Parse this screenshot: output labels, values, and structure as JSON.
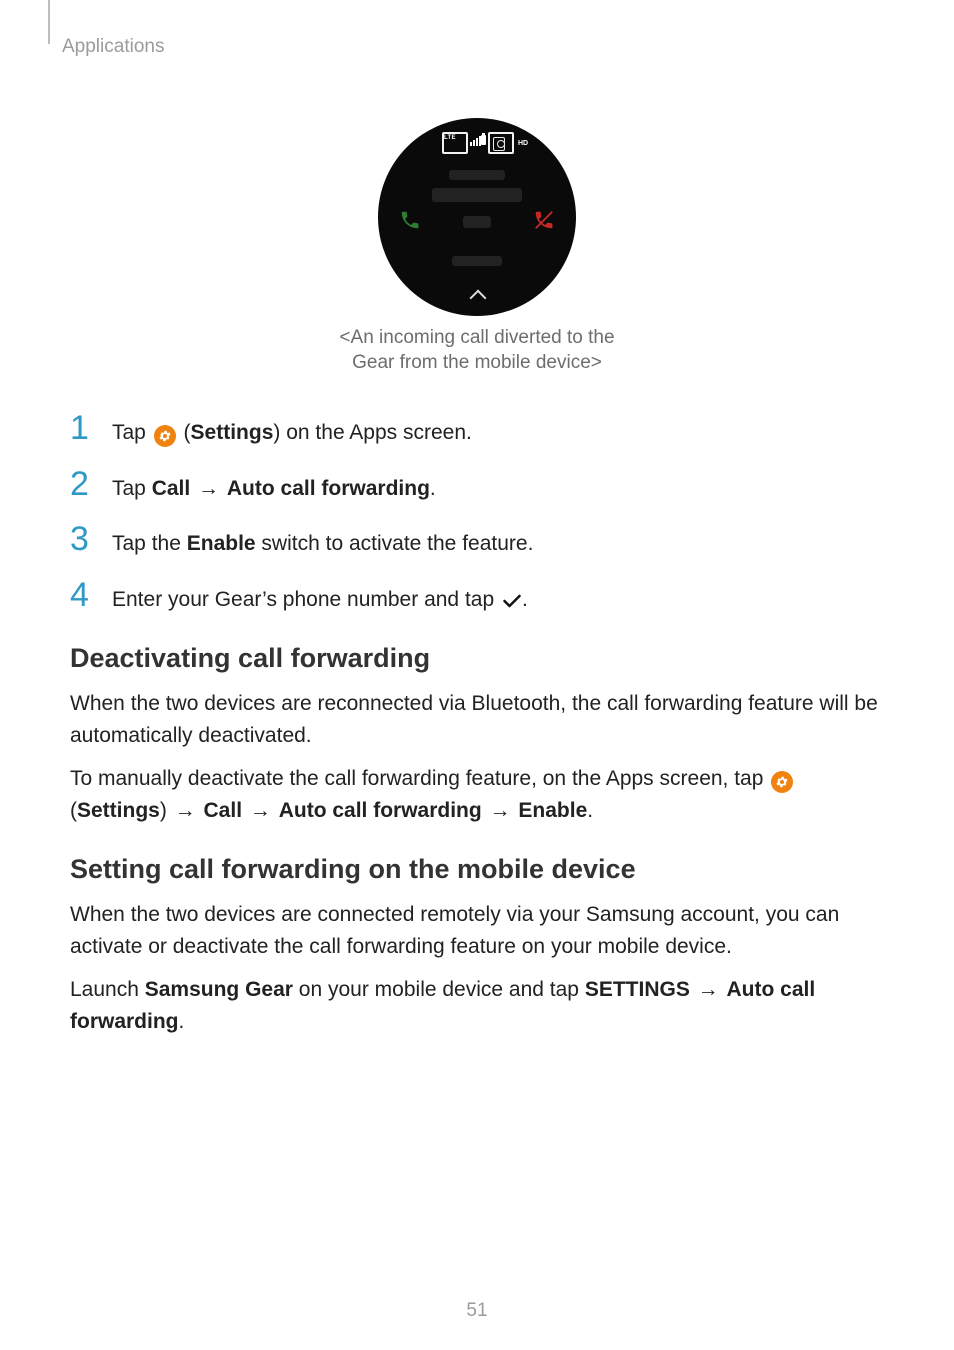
{
  "header": {
    "section_label": "Applications"
  },
  "figure": {
    "status": {
      "lte": "LTE",
      "hd": "HD"
    },
    "caption_line1": "<An incoming call diverted to the",
    "caption_line2": "Gear from the mobile device>"
  },
  "steps": [
    {
      "num": "1",
      "pre": "Tap ",
      "bold_after_icon_open": "(",
      "bold_after_icon_label": "Settings",
      "bold_after_icon_close": ")",
      "post": " on the Apps screen."
    },
    {
      "num": "2",
      "pre": "Tap ",
      "b1": "Call",
      "arrow": " → ",
      "b2": "Auto call forwarding",
      "post": "."
    },
    {
      "num": "3",
      "pre": "Tap the ",
      "b1": "Enable",
      "post": " switch to activate the feature."
    },
    {
      "num": "4",
      "pre": "Enter your Gear’s phone number and tap ",
      "post": "."
    }
  ],
  "sections": {
    "deactivate": {
      "title": "Deactivating call forwarding",
      "p1": "When the two devices are reconnected via Bluetooth, the call forwarding feature will be automatically deactivated.",
      "p2_pre": "To manually deactivate the call forwarding feature, on the Apps screen, tap ",
      "p2_settings_open": "(",
      "p2_settings_label": "Settings",
      "p2_settings_close": ")",
      "p2_arrow1": " → ",
      "p2_b_call": "Call",
      "p2_arrow2": " → ",
      "p2_b_acf": "Auto call forwarding",
      "p2_arrow3": " → ",
      "p2_b_enable": "Enable",
      "p2_end": "."
    },
    "mobile": {
      "title": "Setting call forwarding on the mobile device",
      "p1": "When the two devices are connected remotely via your Samsung account, you can activate or deactivate the call forwarding feature on your mobile device.",
      "p2_pre": "Launch ",
      "p2_b_gear": "Samsung Gear",
      "p2_mid": " on your mobile device and tap ",
      "p2_b_settings": "SETTINGS",
      "p2_arrow": " → ",
      "p2_b_acf": "Auto call forwarding",
      "p2_end": "."
    }
  },
  "page_number": "51"
}
